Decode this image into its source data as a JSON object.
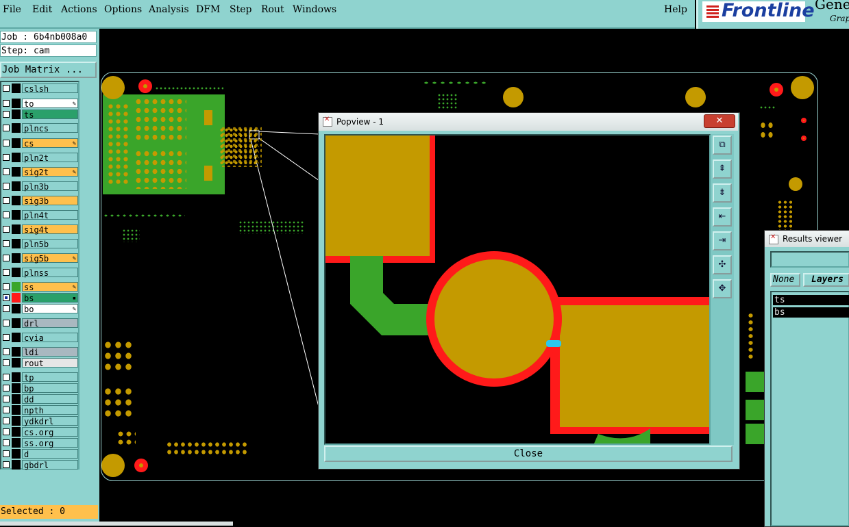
{
  "menu": {
    "items": [
      "File",
      "Edit",
      "Actions",
      "Options",
      "Analysis",
      "DFM",
      "Step",
      "Rout",
      "Windows"
    ],
    "help": "Help"
  },
  "branding": {
    "logo": "Frontline",
    "product": "Gene",
    "sub": "Grap"
  },
  "job": {
    "job_line": "Job : 6b4nb008a0",
    "step_line": "Step: cam",
    "matrix_button": "Job Matrix ..."
  },
  "layers": [
    {
      "name": "cslsh",
      "color": "#000000",
      "bg": "#8fd3cf",
      "lock": ""
    },
    {
      "name": "to",
      "color": "#000000",
      "bg": "#ffffff",
      "lock": "✎"
    },
    {
      "name": "ts",
      "color": "#000000",
      "bg": "#2aa06a",
      "lock": ""
    },
    {
      "name": "plncs",
      "color": "#000000",
      "bg": "#8fd3cf",
      "lock": ""
    },
    {
      "name": "cs",
      "color": "#000000",
      "bg": "#ffc04c",
      "lock": "✎"
    },
    {
      "name": "pln2t",
      "color": "#000000",
      "bg": "#8fd3cf",
      "lock": ""
    },
    {
      "name": "sig2t",
      "color": "#000000",
      "bg": "#ffc04c",
      "lock": "✎"
    },
    {
      "name": "pln3b",
      "color": "#000000",
      "bg": "#8fd3cf",
      "lock": ""
    },
    {
      "name": "sig3b",
      "color": "#000000",
      "bg": "#ffc04c",
      "lock": ""
    },
    {
      "name": "pln4t",
      "color": "#000000",
      "bg": "#8fd3cf",
      "lock": ""
    },
    {
      "name": "sig4t",
      "color": "#000000",
      "bg": "#ffc04c",
      "lock": ""
    },
    {
      "name": "pln5b",
      "color": "#000000",
      "bg": "#8fd3cf",
      "lock": ""
    },
    {
      "name": "sig5b",
      "color": "#000000",
      "bg": "#ffc04c",
      "lock": "✎"
    },
    {
      "name": "plnss",
      "color": "#000000",
      "bg": "#8fd3cf",
      "lock": ""
    },
    {
      "name": "ss",
      "color": "#3aa52a",
      "bg": "#ffc04c",
      "lock": "✎"
    },
    {
      "name": "bs",
      "color": "#ff1a1a",
      "bg": "#2aa06a",
      "lock": "▪",
      "checked": true
    },
    {
      "name": "bo",
      "color": "#000000",
      "bg": "#ffffff",
      "lock": "✎"
    },
    {
      "name": "drl",
      "color": "#000000",
      "bg": "#a9b8c0",
      "lock": ""
    },
    {
      "name": "cvia",
      "color": "#000000",
      "bg": "#8fd3cf",
      "lock": ""
    },
    {
      "name": "ldi",
      "color": "#000000",
      "bg": "#a9b8c0",
      "lock": ""
    },
    {
      "name": "rout",
      "color": "#000000",
      "bg": "#e6e6e6",
      "lock": ""
    },
    {
      "name": "tp",
      "color": "#000000",
      "bg": "#8fd3cf",
      "lock": ""
    },
    {
      "name": "bp",
      "color": "#000000",
      "bg": "#8fd3cf",
      "lock": ""
    },
    {
      "name": "dd",
      "color": "#000000",
      "bg": "#8fd3cf",
      "lock": ""
    },
    {
      "name": "npth",
      "color": "#000000",
      "bg": "#8fd3cf",
      "lock": ""
    },
    {
      "name": "ydkdrl",
      "color": "#000000",
      "bg": "#8fd3cf",
      "lock": ""
    },
    {
      "name": "cs.org",
      "color": "#000000",
      "bg": "#8fd3cf",
      "lock": ""
    },
    {
      "name": "ss.org",
      "color": "#000000",
      "bg": "#8fd3cf",
      "lock": ""
    },
    {
      "name": "d",
      "color": "#000000",
      "bg": "#8fd3cf",
      "lock": ""
    },
    {
      "name": "gbdrl",
      "color": "#000000",
      "bg": "#8fd3cf",
      "lock": ""
    }
  ],
  "selected": "Selected : 0",
  "popview": {
    "title": "Popview - 1",
    "close_x": "✕",
    "close_button": "Close"
  },
  "results": {
    "title": "Results viewer",
    "btn_none": "None",
    "btn_layers": "Layers",
    "rows": [
      "ts",
      "bs"
    ]
  },
  "colors": {
    "panel": "#8fd3cf",
    "copper": "#c49a00",
    "mask": "#ff1a1a",
    "silk": "#3aa52a"
  }
}
